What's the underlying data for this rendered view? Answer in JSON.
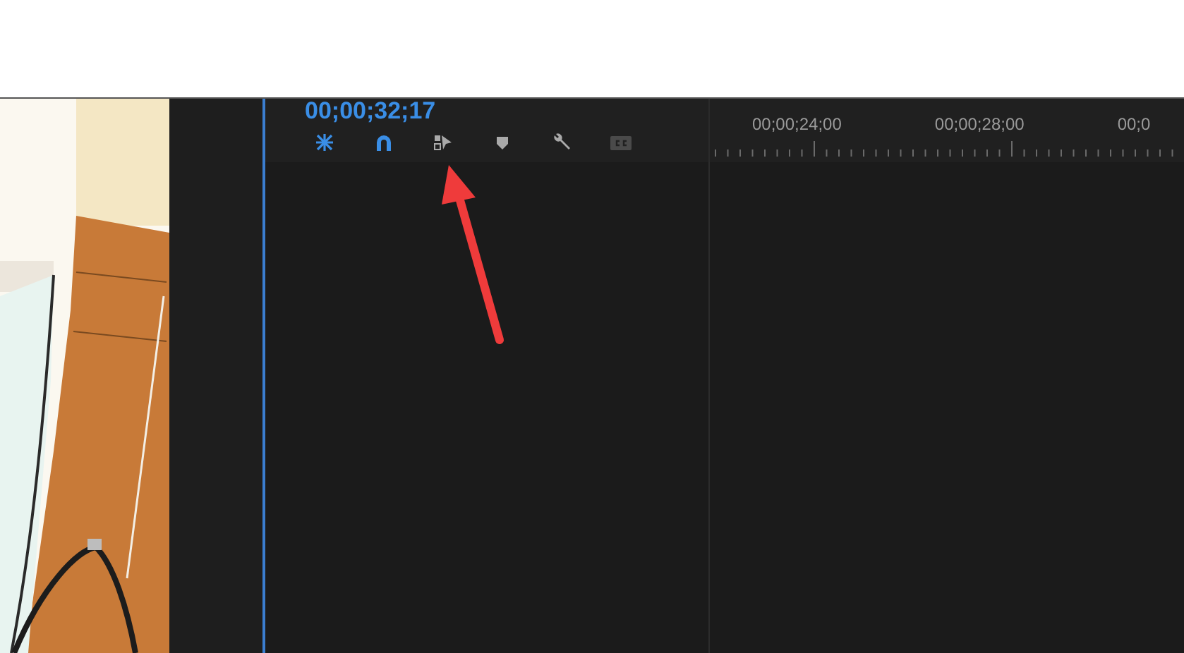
{
  "timeline": {
    "timecode": "00;00;32;17",
    "tools": [
      {
        "kind": "snap",
        "on": true,
        "disabled": false
      },
      {
        "kind": "linked",
        "on": true,
        "disabled": false
      },
      {
        "kind": "insert",
        "on": false,
        "disabled": false
      },
      {
        "kind": "marker",
        "on": false,
        "disabled": false
      },
      {
        "kind": "wrench",
        "on": false,
        "disabled": false
      },
      {
        "kind": "captions",
        "on": false,
        "disabled": true
      }
    ],
    "ruler_labels": [
      "00;00;24;00",
      "00;00;28;00",
      "00;0"
    ]
  }
}
